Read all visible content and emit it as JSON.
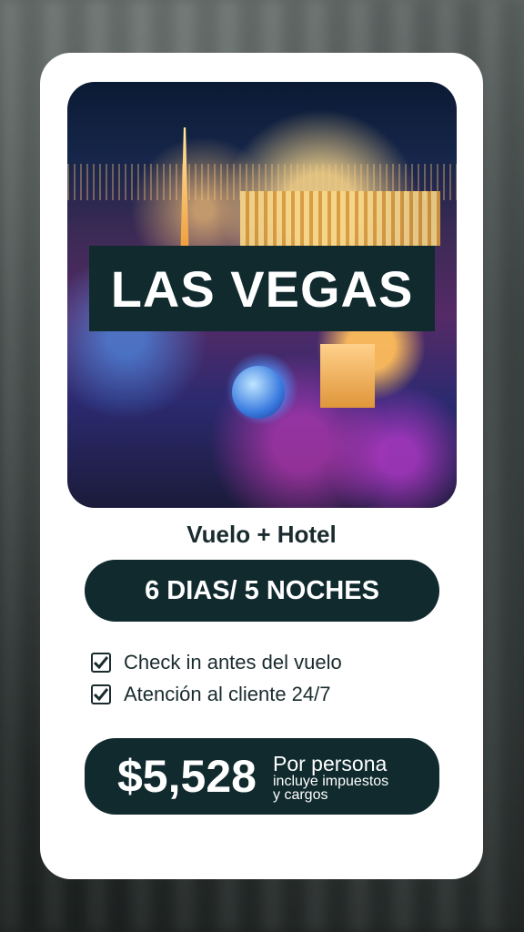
{
  "destination": "LAS VEGAS",
  "package_type": "Vuelo + Hotel",
  "duration": "6 DIAS/ 5 NOCHES",
  "features": [
    {
      "label": "Check in antes del vuelo",
      "icon": "checkbox-checked-icon"
    },
    {
      "label": "Atención al cliente 24/7",
      "icon": "checkbox-checked-icon"
    }
  ],
  "price": {
    "amount": "$5,528",
    "per": "Por persona",
    "note_line1": "incluye impuestos",
    "note_line2": "y cargos"
  },
  "colors": {
    "dark": "#102a2e",
    "card": "#ffffff",
    "text": "#1a2b2e"
  }
}
